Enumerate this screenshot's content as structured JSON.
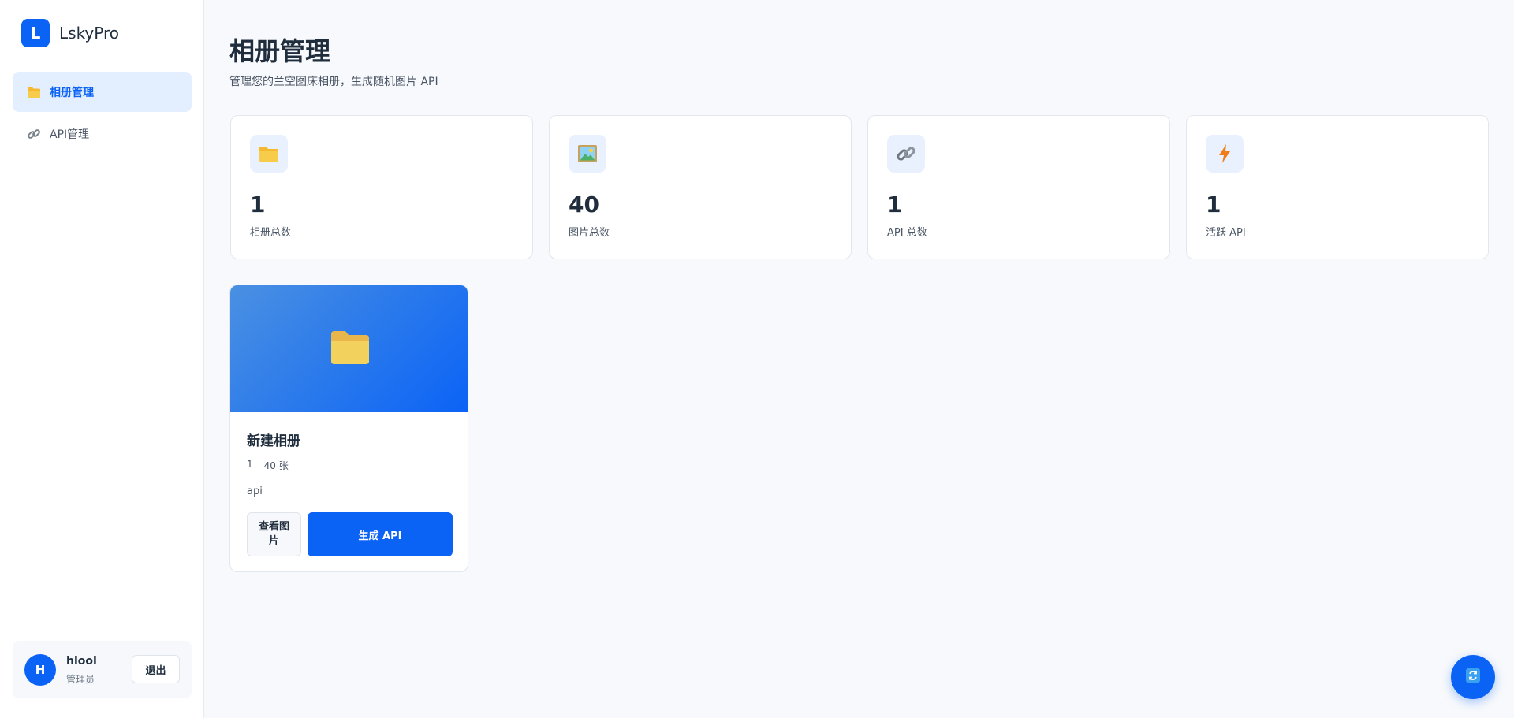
{
  "brand": {
    "logo_letter": "L",
    "name": "LskyPro"
  },
  "sidebar": {
    "items": [
      {
        "label": "相册管理",
        "icon": "folder-icon",
        "active": true
      },
      {
        "label": "API管理",
        "icon": "link-icon",
        "active": false
      }
    ]
  },
  "user": {
    "initial": "H",
    "name": "hlool",
    "role": "管理员",
    "logout_label": "退出"
  },
  "header": {
    "title": "相册管理",
    "subtitle": "管理您的兰空图床相册，生成随机图片 API"
  },
  "stats": [
    {
      "value": "1",
      "label": "相册总数",
      "icon": "folder-icon"
    },
    {
      "value": "40",
      "label": "图片总数",
      "icon": "picture-icon"
    },
    {
      "value": "1",
      "label": "API 总数",
      "icon": "link-icon"
    },
    {
      "value": "1",
      "label": "活跃 API",
      "icon": "lightning-icon"
    }
  ],
  "albums": [
    {
      "title": "新建相册",
      "id": "1",
      "count": "40 张",
      "tag": "api",
      "view_label": "查看图片",
      "generate_label": "生成 API"
    }
  ],
  "fab": {
    "icon": "refresh-icon"
  },
  "colors": {
    "accent": "#0b63f6",
    "active_bg": "#e3efff",
    "folder": "#f5c242",
    "bolt": "#f07d1a"
  }
}
